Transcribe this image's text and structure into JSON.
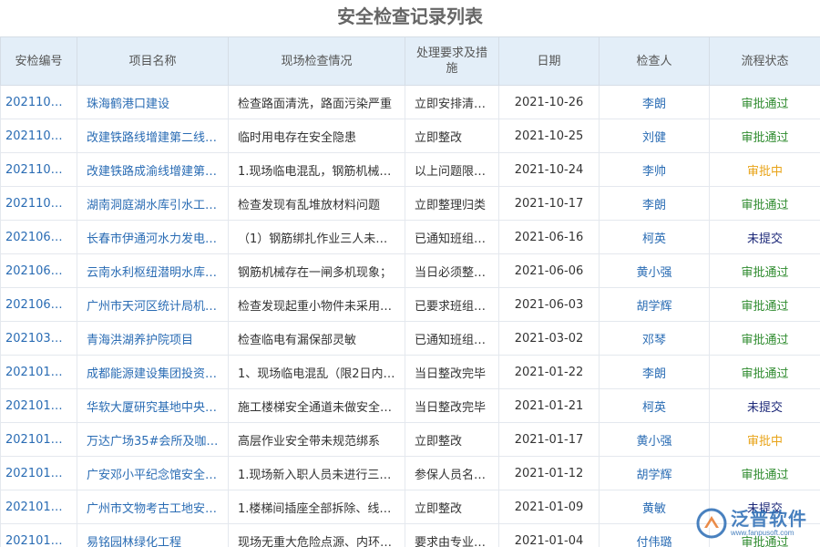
{
  "page_title": "安全检查记录列表",
  "columns": [
    "安检编号",
    "项目名称",
    "现场检查情况",
    "处理要求及措施",
    "日期",
    "检查人",
    "流程状态"
  ],
  "status_colors": {
    "审批通过": "#2e8b2e",
    "审批中": "#e8a317",
    "未提交": "#1e2a7a"
  },
  "rows": [
    {
      "id": "2021100…",
      "project": "珠海鹤港口建设",
      "check": "检查路面清洗，路面污染严重",
      "handle": "立即安排清…",
      "date": "2021-10-26",
      "inspector": "李朗",
      "status": "审批通过"
    },
    {
      "id": "2021100…",
      "project": "改建铁路线增建第二线…",
      "check": "临时用电存在安全隐患",
      "handle": "立即整改",
      "date": "2021-10-25",
      "inspector": "刘健",
      "status": "审批通过"
    },
    {
      "id": "2021100…",
      "project": "改建铁路成渝线增建第…",
      "check": "1.现场临电混乱，钢筋机械…",
      "handle": "以上问题限…",
      "date": "2021-10-24",
      "inspector": "李帅",
      "status": "审批中"
    },
    {
      "id": "2021100…",
      "project": "湖南洞庭湖水库引水工…",
      "check": "检查发现有乱堆放材料问题",
      "handle": "立即整理归类",
      "date": "2021-10-17",
      "inspector": "李朗",
      "status": "审批通过"
    },
    {
      "id": "2021060…",
      "project": "长春市伊通河水力发电…",
      "check": "（1）钢筋绑扎作业三人未…",
      "handle": "已通知班组…",
      "date": "2021-06-16",
      "inspector": "柯英",
      "status": "未提交"
    },
    {
      "id": "2021060…",
      "project": "云南水利枢纽潜明水库…",
      "check": "钢筋机械存在一闸多机现象；",
      "handle": "当日必须整…",
      "date": "2021-06-06",
      "inspector": "黄小强",
      "status": "审批通过"
    },
    {
      "id": "2021060…",
      "project": "广州市天河区统计局机…",
      "check": "检查发现起重小物件未采用…",
      "handle": "已要求班组…",
      "date": "2021-06-03",
      "inspector": "胡学辉",
      "status": "审批通过"
    },
    {
      "id": "2021030…",
      "project": "青海洪湖养护院项目",
      "check": "检查临电有漏保部灵敏",
      "handle": "已通知班组…",
      "date": "2021-03-02",
      "inspector": "邓琴",
      "status": "审批通过"
    },
    {
      "id": "2021010…",
      "project": "成都能源建设集团投资…",
      "check": "1、现场临电混乱（限2日内…",
      "handle": "当日整改完毕",
      "date": "2021-01-22",
      "inspector": "李朗",
      "status": "审批通过"
    },
    {
      "id": "2021010…",
      "project": "华软大厦研究基地中央…",
      "check": "施工楼梯安全通道未做安全…",
      "handle": "当日整改完毕",
      "date": "2021-01-21",
      "inspector": "柯英",
      "status": "未提交"
    },
    {
      "id": "2021010…",
      "project": "万达广场35#会所及咖…",
      "check": "高层作业安全带未规范绑系",
      "handle": "立即整改",
      "date": "2021-01-17",
      "inspector": "黄小强",
      "status": "审批中"
    },
    {
      "id": "2021010…",
      "project": "广安邓小平纪念馆安全…",
      "check": "1.现场新入职人员未进行三…",
      "handle": "参保人员名…",
      "date": "2021-01-12",
      "inspector": "胡学辉",
      "status": "审批通过"
    },
    {
      "id": "2021010…",
      "project": "广州市文物考古工地安…",
      "check": "1.楼梯间插座全部拆除、线…",
      "handle": "立即整改",
      "date": "2021-01-09",
      "inspector": "黄敏",
      "status": "未提交"
    },
    {
      "id": "2021010…",
      "project": "易铭园林绿化工程",
      "check": "现场无重大危险点源、内环…",
      "handle": "要求由专业…",
      "date": "2021-01-04",
      "inspector": "付伟璐",
      "status": "审批通过"
    }
  ],
  "logo": {
    "name": "泛普软件",
    "url": "www.fanpusoft.com",
    "icon": "fanpu-logo-icon"
  }
}
